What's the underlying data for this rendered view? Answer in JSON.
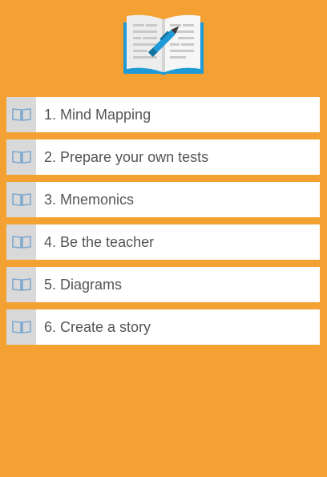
{
  "app": {
    "logo_icon": "open-book-with-pen-icon"
  },
  "colors": {
    "background": "#F4A133",
    "item_background": "#FFFFFF",
    "icon_box": "#D9D9D9",
    "label_text": "#555555",
    "book_icon_blue": "#7FA9CF"
  },
  "menu": {
    "item_icon": "book-icon",
    "items": [
      {
        "label": "1. Mind Mapping"
      },
      {
        "label": "2. Prepare your own tests"
      },
      {
        "label": "3. Mnemonics"
      },
      {
        "label": "4. Be the teacher"
      },
      {
        "label": "5. Diagrams"
      },
      {
        "label": "6. Create a story"
      }
    ]
  }
}
